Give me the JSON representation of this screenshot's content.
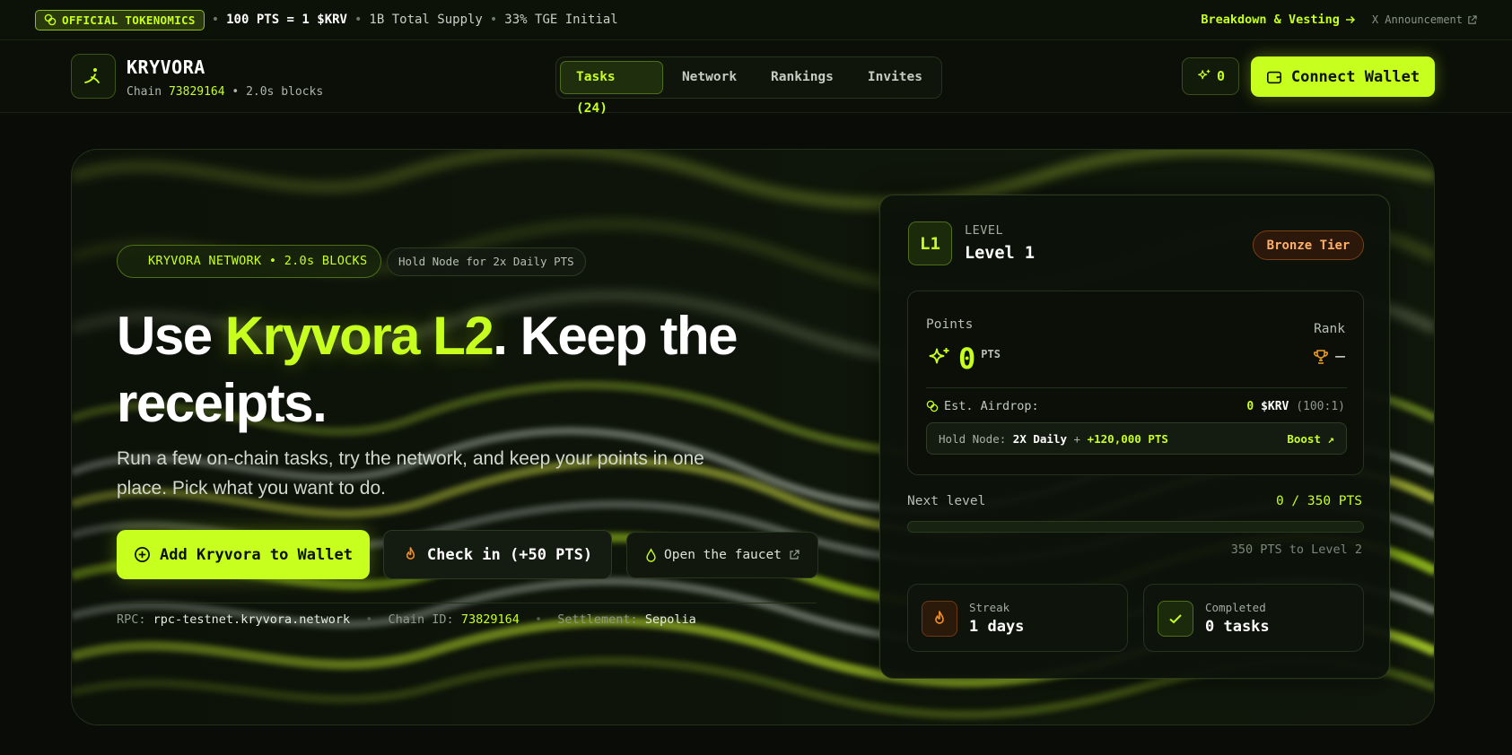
{
  "topbar": {
    "badge": "OFFICIAL TOKENOMICS",
    "rate": "100 PTS = 1 $KRV",
    "supply": "1B Total Supply",
    "tge": "33% TGE Initial",
    "breakdown_link": "Breakdown & Vesting",
    "x_link": "X Announcement"
  },
  "header": {
    "brand": "KRYVORA",
    "chain_prefix": "Chain",
    "chain_id": "73829164",
    "blocks": "• 2.0s blocks",
    "nav": [
      {
        "label": "Tasks (24)",
        "active": true
      },
      {
        "label": "Network",
        "active": false
      },
      {
        "label": "Rankings",
        "active": false
      },
      {
        "label": "Invites",
        "active": false
      }
    ],
    "points_count": "0",
    "connect_label": "Connect Wallet"
  },
  "hero": {
    "pill_network": "KRYVORA NETWORK • 2.0s BLOCKS",
    "pill_hold": "Hold Node for 2x Daily PTS",
    "headline_pre": "Use ",
    "headline_accent": "Kryvora L2",
    "headline_post": ". Keep the receipts.",
    "subcopy": "Run a few on-chain tasks, try the network, and keep your points in one place. Pick what you want to do.",
    "btn_add": "Add Kryvora to Wallet",
    "btn_checkin": "Check in (+50 PTS)",
    "btn_faucet": "Open the faucet",
    "rpc_label": "RPC:",
    "rpc_value": "rpc-testnet.kryvora.network",
    "chain_label": "Chain ID:",
    "chain_value": "73829164",
    "settlement_label": "Settlement:",
    "settlement_value": "Sepolia"
  },
  "level_card": {
    "badge": "L1",
    "label": "LEVEL",
    "name": "Level 1",
    "tier": "Bronze Tier",
    "points_label": "Points",
    "points_value": "0",
    "points_unit": "PTS",
    "rank_label": "Rank",
    "rank_value": "—",
    "airdrop_label": "Est. Airdrop:",
    "airdrop_amount": "0",
    "airdrop_token": "$KRV",
    "airdrop_ratio": "(100:1)",
    "hold_prefix": "Hold Node:",
    "hold_mult": "2X Daily",
    "hold_plus": "+",
    "hold_bonus": "+120,000 PTS",
    "boost_label": "Boost ↗",
    "next_label": "Next level",
    "next_value": "0 / 350 PTS",
    "progress_fraction": 0,
    "to_level": "350 PTS to Level 2",
    "streak_label": "Streak",
    "streak_value": "1 days",
    "completed_label": "Completed",
    "completed_value": "0 tasks"
  },
  "colors": {
    "accent": "#c7ff1e",
    "background": "#090c07",
    "tier_orange": "#ffb066",
    "streak_orange": "#f08a24"
  },
  "icons": [
    "coins-icon",
    "arrow-right-icon",
    "external-link-icon",
    "logo-icon",
    "sparkles-icon",
    "wallet-icon",
    "plus-circle-icon",
    "flame-icon",
    "droplet-icon",
    "trophy-icon",
    "check-icon"
  ]
}
